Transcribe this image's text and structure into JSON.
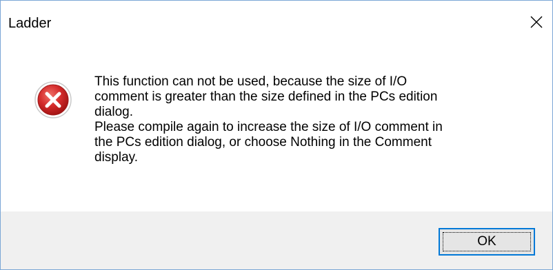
{
  "window": {
    "title": "Ladder"
  },
  "dialog": {
    "icon": "error-icon",
    "message_lines": [
      "This function can not be used, because the size of I/O",
      "comment is greater than the size defined in the PCs edition",
      "dialog.",
      "Please compile again to increase the size of I/O comment in",
      "the PCs edition dialog, or choose Nothing in the Comment",
      "display."
    ]
  },
  "buttons": {
    "ok_label": "OK",
    "close_icon": "close-icon"
  },
  "colors": {
    "error_red": "#d42b2b",
    "footer_bg": "#f0f0f0",
    "focus_border": "#0078d7"
  }
}
